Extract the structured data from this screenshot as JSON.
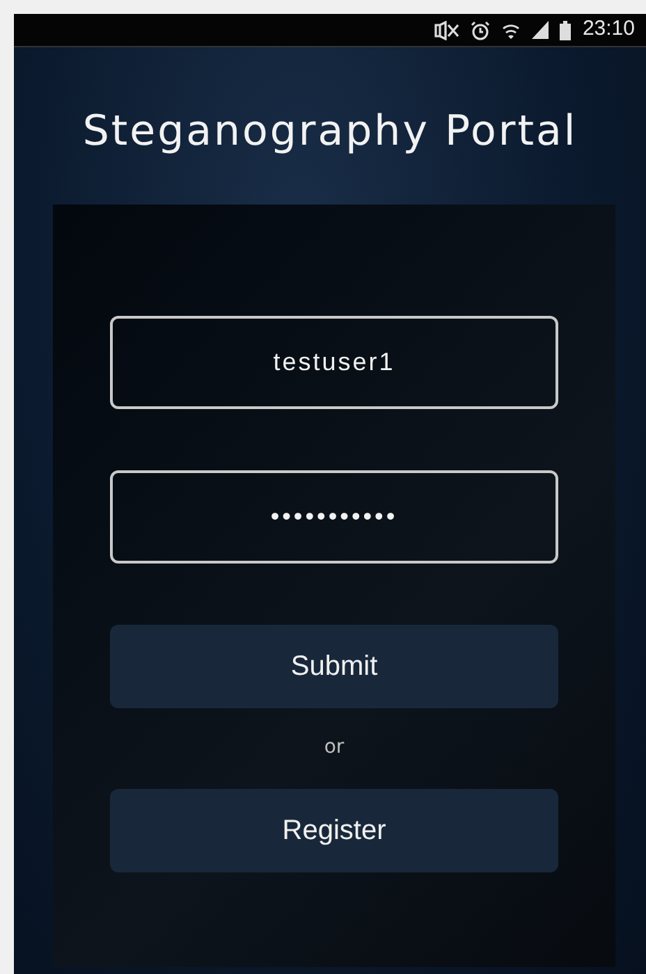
{
  "status_bar": {
    "time": "23:10"
  },
  "title": "Steganography Portal",
  "fields": [
    {
      "kind": "text",
      "value": "testuser1"
    },
    {
      "kind": "password",
      "value": "•••••••••••"
    }
  ],
  "buttons": [
    {
      "kind": "button",
      "label": "Submit"
    },
    {
      "kind": "separator",
      "label": "or"
    },
    {
      "kind": "button",
      "label": "Register"
    }
  ]
}
